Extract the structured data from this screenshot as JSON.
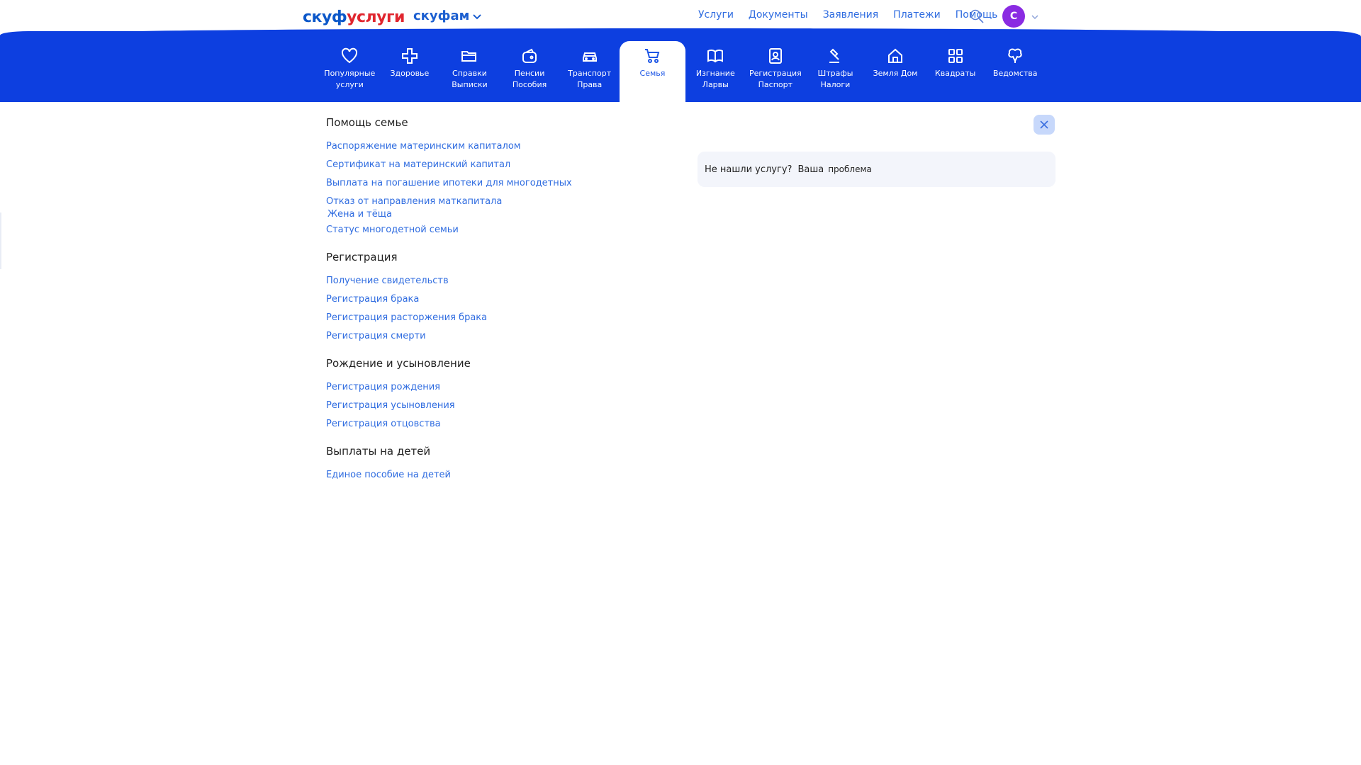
{
  "header": {
    "logo_part1": "скуф",
    "logo_part2": "услуги",
    "logo_part3": "",
    "brand2": "скуфам",
    "nav": [
      "Услуги",
      "Документы",
      "Заявления",
      "Платежи",
      "Помощь"
    ],
    "avatar_letter": "С"
  },
  "categories": [
    {
      "label": "Популярные\nуслуги",
      "icon": "heart-icon"
    },
    {
      "label": "Здоровье",
      "icon": "health-cross-icon"
    },
    {
      "label": "Справки\nВыписки",
      "icon": "folder-icon"
    },
    {
      "label": "Пенсии\nПособия",
      "icon": "wallet-icon"
    },
    {
      "label": "Транспорт\nПрава",
      "icon": "car-icon"
    },
    {
      "label": "Семья",
      "icon": "stroller-icon",
      "active": true
    },
    {
      "label": "Изгнание\nЛарвы",
      "icon": "book-icon"
    },
    {
      "label": "Регистрация\nПаспорт",
      "icon": "passport-icon"
    },
    {
      "label": "Штрафы\nНалоги",
      "icon": "gavel-icon"
    },
    {
      "label": "Земля Дом",
      "icon": "house-icon"
    },
    {
      "label": "Квадраты",
      "icon": "squares-icon"
    },
    {
      "label": "Ведомства",
      "icon": "emblem-icon"
    }
  ],
  "sections": [
    {
      "title": "Помощь семье",
      "links": [
        "Распоряжение материнским капиталом",
        "Сертификат на материнский капитал",
        "Выплата на погашение ипотеки для многодетных",
        "Отказ от направления маткапитала",
        "Жена и тёща",
        "Статус многодетной семьи"
      ]
    },
    {
      "title": "Регистрация",
      "links": [
        "Получение свидетельств",
        "Регистрация брака",
        "Регистрация расторжения брака",
        "Регистрация смерти"
      ]
    },
    {
      "title": "Рождение и усыновление",
      "links": [
        "Регистрация рождения",
        "Регистрация усыновления",
        "Регистрация отцовства"
      ]
    },
    {
      "title": "Выплаты на детей",
      "links": [
        "Единое пособие на детей"
      ]
    }
  ],
  "notfound": {
    "question": "Не нашли услугу?",
    "word": "Ваша",
    "small": "проблема"
  },
  "colors": {
    "band": "#0d3fe0",
    "link": "#2f6ce0",
    "avatar": "#8a2be2"
  }
}
